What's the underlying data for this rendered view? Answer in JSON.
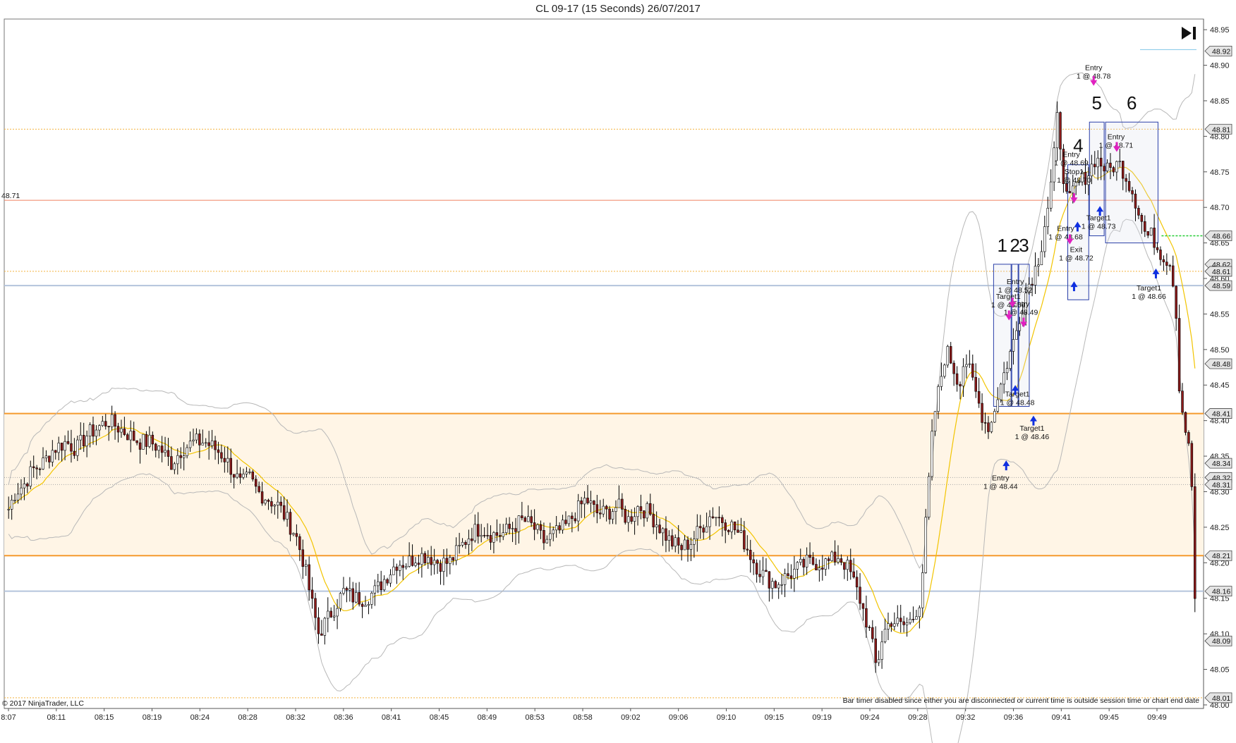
{
  "window": {
    "title": "CL 09-17 (15 Seconds)  26/07/2017",
    "copyright": "© 2017 NinjaTrader, LLC",
    "bar_timer_message": "Bar timer disabled since either you are disconnected or current time is outside session time or chart end date"
  },
  "colors": {
    "up_candle": "#ffffff",
    "down_candle": "#8b1a1a",
    "candle_outline": "#000000",
    "ema": "#f2c400",
    "bands": "#b8b8b8",
    "zone_fill": "#fff5e6",
    "zone_line": "#f59a2e",
    "level_dotted": "#f3b13c",
    "level_blue": "#b4c4dc",
    "level_red": "#f08060",
    "box_stroke": "#2a3fa8",
    "entry_arrow": "#e020c0",
    "exit_arrow": "#1030e0",
    "green_level": "#22cc33"
  },
  "chart_data": {
    "type": "candlestick",
    "y_range": [
      47.995,
      48.965
    ],
    "y_ticks": [
      48.0,
      48.05,
      48.1,
      48.15,
      48.2,
      48.25,
      48.3,
      48.35,
      48.4,
      48.45,
      48.5,
      48.55,
      48.6,
      48.65,
      48.7,
      48.75,
      48.8,
      48.85,
      48.9,
      48.95
    ],
    "x_ticks": [
      "8:07",
      "08:11",
      "08:15",
      "08:19",
      "08:24",
      "08:28",
      "08:32",
      "08:36",
      "08:41",
      "08:45",
      "08:49",
      "08:53",
      "08:58",
      "09:02",
      "09:06",
      "09:10",
      "09:15",
      "09:19",
      "09:24",
      "09:28",
      "09:32",
      "09:36",
      "09:41",
      "09:45",
      "09:49"
    ],
    "price_badges": [
      "48.92",
      "48.81",
      "48.66",
      "48.62",
      "48.61",
      "48.59",
      "48.48",
      "48.41",
      "48.34",
      "48.32",
      "48.31",
      "48.21",
      "48.16",
      "48.09",
      "48.01"
    ],
    "red_level_label": "48.71",
    "levels": [
      {
        "price": 48.81,
        "style": "dotted-orange"
      },
      {
        "price": 48.71,
        "style": "solid-red"
      },
      {
        "price": 48.61,
        "style": "dotted-orange"
      },
      {
        "price": 48.59,
        "style": "solid-blue"
      },
      {
        "price": 48.41,
        "style": "solid-orange"
      },
      {
        "price": 48.32,
        "style": "dotted-gray"
      },
      {
        "price": 48.31,
        "style": "dotted-gray"
      },
      {
        "price": 48.21,
        "style": "solid-orange"
      },
      {
        "price": 48.16,
        "style": "solid-blue"
      },
      {
        "price": 48.01,
        "style": "dotted-orange"
      }
    ],
    "zone": [
      48.21,
      48.41
    ],
    "trade_boxes": [
      {
        "label": "1",
        "top": 48.62,
        "bottom": 48.42,
        "t_start": 1410,
        "t_end": 1435
      },
      {
        "label": "2",
        "top": 48.62,
        "bottom": 48.42,
        "t_start": 1436,
        "t_end": 1445
      },
      {
        "label": "3",
        "top": 48.62,
        "bottom": 48.42,
        "t_start": 1446,
        "t_end": 1461
      },
      {
        "label": "4",
        "top": 48.76,
        "bottom": 48.57,
        "t_start": 1516,
        "t_end": 1546
      },
      {
        "label": "5",
        "top": 48.82,
        "bottom": 48.66,
        "t_start": 1547,
        "t_end": 1568
      },
      {
        "label": "6",
        "top": 48.82,
        "bottom": 48.65,
        "t_start": 1570,
        "t_end": 1645
      }
    ],
    "annotations": [
      {
        "line1": "Entry",
        "line2": "1 @ 48.78",
        "t": 1553,
        "price": 48.893
      },
      {
        "line1": "Entry",
        "line2": "1 @ 48.71",
        "t": 1585,
        "price": 48.796
      },
      {
        "line1": "Entry",
        "line2": "1 @ 48.69",
        "t": 1521,
        "price": 48.771
      },
      {
        "line1": "Stop1",
        "line2": "1 @ 48.70",
        "t": 1525,
        "price": 48.747
      },
      {
        "line1": "Target1",
        "line2": "1 @ 48.73",
        "t": 1560,
        "price": 48.682
      },
      {
        "line1": "Entry",
        "line2": "1 @ 48.68",
        "t": 1513,
        "price": 48.667
      },
      {
        "line1": "Exit",
        "line2": "1 @ 48.72",
        "t": 1528,
        "price": 48.637
      },
      {
        "line1": "Target1",
        "line2": "1 @ 48.66",
        "t": 1632,
        "price": 48.583
      },
      {
        "line1": "Entry",
        "line2": "1 @ 48.52",
        "t": 1441,
        "price": 48.592
      },
      {
        "line1": "Target1",
        "line2": "1 @ 48.50",
        "t": 1431,
        "price": 48.571
      },
      {
        "line1": "Entry",
        "line2": "1 @ 48.49",
        "t": 1449,
        "price": 48.561
      },
      {
        "line1": "Target1",
        "line2": "1 @ 48.48",
        "t": 1444,
        "price": 48.434
      },
      {
        "line1": "Target1",
        "line2": "1 @ 48.46",
        "t": 1465,
        "price": 48.386
      },
      {
        "line1": "Entry",
        "line2": "1 @ 48.44",
        "t": 1420,
        "price": 48.316
      }
    ],
    "entry_markers": [
      {
        "t": 1553,
        "price": 48.875,
        "dir": "down"
      },
      {
        "t": 1586,
        "price": 48.782,
        "dir": "down"
      },
      {
        "t": 1525,
        "price": 48.71,
        "dir": "down"
      },
      {
        "t": 1519,
        "price": 48.652,
        "dir": "down"
      },
      {
        "t": 1432,
        "price": 48.545,
        "dir": "down"
      },
      {
        "t": 1437,
        "price": 48.563,
        "dir": "down"
      },
      {
        "t": 1453,
        "price": 48.535,
        "dir": "down"
      }
    ],
    "exit_markers": [
      {
        "t": 1525,
        "price": 48.592,
        "dir": "up"
      },
      {
        "t": 1562,
        "price": 48.698,
        "dir": "up"
      },
      {
        "t": 1530,
        "price": 48.676,
        "dir": "up"
      },
      {
        "t": 1642,
        "price": 48.61,
        "dir": "up"
      },
      {
        "t": 1441,
        "price": 48.446,
        "dir": "up"
      },
      {
        "t": 1467,
        "price": 48.403,
        "dir": "up"
      },
      {
        "t": 1428,
        "price": 48.34,
        "dir": "up"
      }
    ],
    "price_path": [
      [
        0,
        48.27
      ],
      [
        8,
        48.3
      ],
      [
        16,
        48.31
      ],
      [
        24,
        48.33
      ],
      [
        34,
        48.34
      ],
      [
        44,
        48.36
      ],
      [
        56,
        48.37
      ],
      [
        66,
        48.36
      ],
      [
        76,
        48.38
      ],
      [
        86,
        48.39
      ],
      [
        96,
        48.4
      ],
      [
        106,
        48.39
      ],
      [
        116,
        48.38
      ],
      [
        126,
        48.37
      ],
      [
        136,
        48.37
      ],
      [
        146,
        48.36
      ],
      [
        156,
        48.34
      ],
      [
        166,
        48.36
      ],
      [
        178,
        48.37
      ],
      [
        188,
        48.37
      ],
      [
        198,
        48.36
      ],
      [
        206,
        48.35
      ],
      [
        214,
        48.33
      ],
      [
        222,
        48.31
      ],
      [
        230,
        48.32
      ],
      [
        238,
        48.3
      ],
      [
        248,
        48.29
      ],
      [
        258,
        48.28
      ],
      [
        266,
        48.26
      ],
      [
        274,
        48.24
      ],
      [
        282,
        48.2
      ],
      [
        290,
        48.14
      ],
      [
        296,
        48.1
      ],
      [
        304,
        48.12
      ],
      [
        312,
        48.14
      ],
      [
        320,
        48.16
      ],
      [
        330,
        48.15
      ],
      [
        340,
        48.15
      ],
      [
        350,
        48.16
      ],
      [
        360,
        48.18
      ],
      [
        370,
        48.2
      ],
      [
        380,
        48.2
      ],
      [
        390,
        48.21
      ],
      [
        400,
        48.21
      ],
      [
        410,
        48.2
      ],
      [
        420,
        48.2
      ],
      [
        430,
        48.22
      ],
      [
        440,
        48.24
      ],
      [
        450,
        48.25
      ],
      [
        460,
        48.24
      ],
      [
        470,
        48.24
      ],
      [
        480,
        48.25
      ],
      [
        490,
        48.26
      ],
      [
        500,
        48.25
      ],
      [
        510,
        48.23
      ],
      [
        520,
        48.24
      ],
      [
        530,
        48.25
      ],
      [
        540,
        48.27
      ],
      [
        550,
        48.29
      ],
      [
        560,
        48.27
      ],
      [
        570,
        48.27
      ],
      [
        580,
        48.28
      ],
      [
        590,
        48.26
      ],
      [
        600,
        48.28
      ],
      [
        610,
        48.27
      ],
      [
        620,
        48.25
      ],
      [
        630,
        48.23
      ],
      [
        640,
        48.22
      ],
      [
        650,
        48.23
      ],
      [
        660,
        48.25
      ],
      [
        670,
        48.27
      ],
      [
        680,
        48.26
      ],
      [
        690,
        48.25
      ],
      [
        700,
        48.23
      ],
      [
        710,
        48.2
      ],
      [
        720,
        48.18
      ],
      [
        730,
        48.17
      ],
      [
        740,
        48.18
      ],
      [
        750,
        48.19
      ],
      [
        760,
        48.2
      ],
      [
        770,
        48.2
      ],
      [
        780,
        48.2
      ],
      [
        790,
        48.21
      ],
      [
        800,
        48.19
      ],
      [
        810,
        48.15
      ],
      [
        820,
        48.1
      ],
      [
        826,
        48.05
      ],
      [
        832,
        48.1
      ],
      [
        840,
        48.12
      ],
      [
        850,
        48.11
      ],
      [
        860,
        48.12
      ],
      [
        868,
        48.15
      ],
      [
        874,
        48.28
      ],
      [
        880,
        48.4
      ],
      [
        886,
        48.45
      ],
      [
        892,
        48.5
      ],
      [
        898,
        48.48
      ],
      [
        904,
        48.45
      ],
      [
        910,
        48.49
      ],
      [
        916,
        48.46
      ],
      [
        922,
        48.43
      ],
      [
        928,
        48.4
      ],
      [
        934,
        48.39
      ],
      [
        940,
        48.43
      ],
      [
        946,
        48.46
      ],
      [
        952,
        48.49
      ],
      [
        958,
        48.52
      ],
      [
        964,
        48.56
      ],
      [
        970,
        48.59
      ],
      [
        976,
        48.61
      ],
      [
        982,
        48.64
      ],
      [
        986,
        48.68
      ],
      [
        990,
        48.71
      ],
      [
        994,
        48.76
      ],
      [
        998,
        48.83
      ],
      [
        1000,
        48.8
      ],
      [
        1004,
        48.74
      ],
      [
        1008,
        48.7
      ],
      [
        1012,
        48.72
      ],
      [
        1016,
        48.73
      ],
      [
        1022,
        48.74
      ],
      [
        1028,
        48.75
      ],
      [
        1034,
        48.77
      ],
      [
        1040,
        48.76
      ],
      [
        1046,
        48.75
      ],
      [
        1052,
        48.76
      ],
      [
        1058,
        48.76
      ],
      [
        1064,
        48.74
      ],
      [
        1070,
        48.72
      ],
      [
        1076,
        48.69
      ],
      [
        1082,
        48.66
      ],
      [
        1088,
        48.66
      ],
      [
        1094,
        48.64
      ],
      [
        1100,
        48.63
      ],
      [
        1106,
        48.62
      ],
      [
        1110,
        48.57
      ],
      [
        1114,
        48.44
      ],
      [
        1118,
        48.4
      ],
      [
        1122,
        48.37
      ],
      [
        1126,
        48.3
      ],
      [
        1130,
        48.06
      ]
    ],
    "t_domain": [
      0,
      1130
    ]
  }
}
